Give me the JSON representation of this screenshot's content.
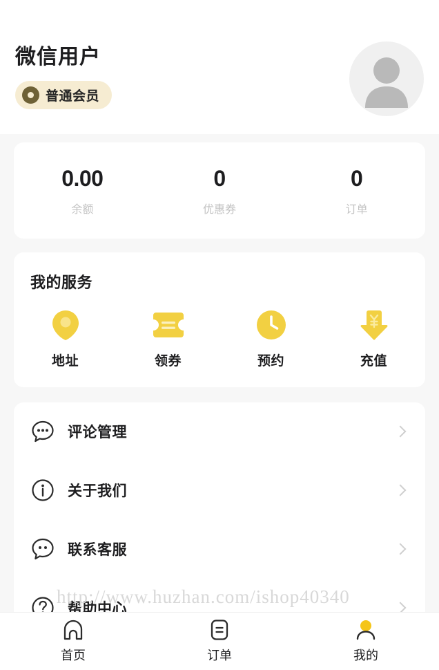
{
  "profile": {
    "name": "微信用户",
    "badge_label": "普通会员",
    "badge_icon": "donut-icon",
    "avatar_icon": "default-avatar-person-icon",
    "badge_bg_color": "#F6ECD2",
    "badge_icon_color": "#6E6136"
  },
  "stats": [
    {
      "value": "0.00",
      "label": "余额"
    },
    {
      "value": "0",
      "label": "优惠券"
    },
    {
      "value": "0",
      "label": "订单"
    }
  ],
  "services": {
    "title": "我的服务",
    "accent_color": "#F2D042",
    "items": [
      {
        "label": "地址",
        "icon": "location-pin-icon"
      },
      {
        "label": "领券",
        "icon": "coupon-ticket-icon"
      },
      {
        "label": "预约",
        "icon": "clock-icon"
      },
      {
        "label": "充值",
        "icon": "recharge-arrow-yuan-icon"
      }
    ]
  },
  "menu": {
    "items": [
      {
        "label": "评论管理",
        "icon": "comment-dots-icon"
      },
      {
        "label": "关于我们",
        "icon": "info-circle-icon"
      },
      {
        "label": "联系客服",
        "icon": "support-chat-icon"
      },
      {
        "label": "帮助中心",
        "icon": "question-circle-icon"
      }
    ]
  },
  "watermark": {
    "text": "http://www.huzhan.com/ishop40340"
  },
  "tabbar": {
    "active_color": "#F5C518",
    "items": [
      {
        "label": "首页",
        "icon": "home-arch-icon",
        "active": false
      },
      {
        "label": "订单",
        "icon": "order-document-icon",
        "active": false
      },
      {
        "label": "我的",
        "icon": "profile-person-icon",
        "active": true
      }
    ]
  }
}
